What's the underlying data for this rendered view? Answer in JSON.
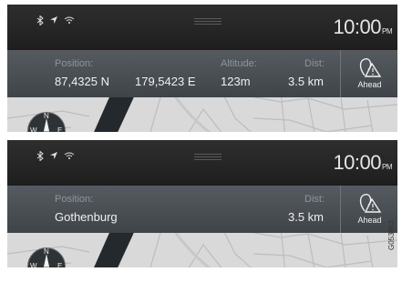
{
  "screen_top": {
    "clock": {
      "time": "10:00",
      "ampm": "PM"
    },
    "status_icons": [
      "bluetooth-icon",
      "gps-arrow-icon",
      "wifi-icon"
    ],
    "info": {
      "position_label": "Position:",
      "latitude": "87,4325 N",
      "longitude": "179,5423 E",
      "altitude_label": "Altitude:",
      "altitude": "123m",
      "distance_label": "Dist:",
      "distance": "3.5 km",
      "ahead_label": "Ahead"
    },
    "compass": {
      "n": "N",
      "w": "W",
      "e": "E"
    }
  },
  "screen_bottom": {
    "clock": {
      "time": "10:00",
      "ampm": "PM"
    },
    "status_icons": [
      "bluetooth-icon",
      "gps-arrow-icon",
      "wifi-icon"
    ],
    "info": {
      "position_label": "Position:",
      "place": "Gothenburg",
      "distance_label": "Dist:",
      "distance": "3.5 km",
      "ahead_label": "Ahead"
    },
    "compass": {
      "n": "N",
      "w": "W",
      "e": "E"
    }
  },
  "figure_code": "G053953",
  "colors": {
    "status_bar": "#262626",
    "info_bar": "#4a5055",
    "map": "#d9d9d9",
    "river": "#23292c"
  }
}
